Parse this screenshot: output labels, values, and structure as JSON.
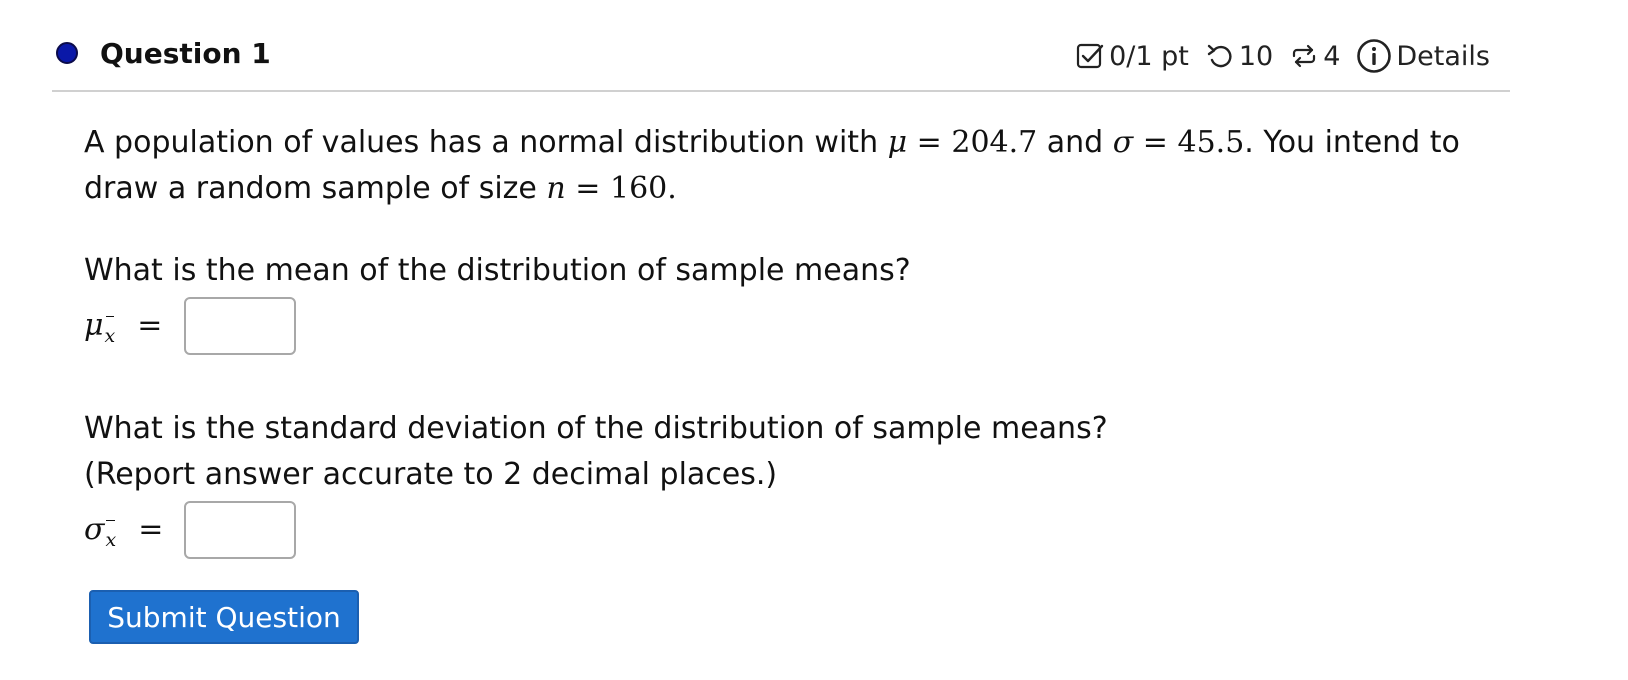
{
  "question": {
    "title": "Question 1",
    "points": "0/1 pt",
    "retries": "10",
    "attempts": "4",
    "details_label": "Details"
  },
  "body": {
    "intro_prefix": "A population of values has a normal distribution with ",
    "mu_symbol": "μ",
    "equals": "=",
    "mu_value": "204.7",
    "and_text": " and ",
    "sigma_symbol": "σ",
    "sigma_value": "45.5",
    "intro_suffix": ". You intend to draw a random sample of size ",
    "n_symbol": "n",
    "n_value": "160",
    "period": ".",
    "q1_text": "What is the mean of the distribution of sample means?",
    "q2_text": "What is the standard deviation of the distribution of sample means?",
    "q2_note": "(Report answer accurate to 2 decimal places.)"
  },
  "answers": {
    "mean_label_symbol": "μ",
    "mean_label_sub": "x",
    "sd_label_symbol": "σ",
    "sd_label_sub": "x",
    "equals": "=",
    "mean_value": "",
    "sd_value": ""
  },
  "submit_label": "Submit Question",
  "colors": {
    "status_dot": "#0a18a8",
    "submit_bg": "#1f72cf",
    "submit_text": "#ffffff"
  },
  "icons": {
    "points": "checkbox-icon",
    "retries": "undo-icon",
    "attempts": "repeat-icon",
    "details": "info-icon"
  }
}
